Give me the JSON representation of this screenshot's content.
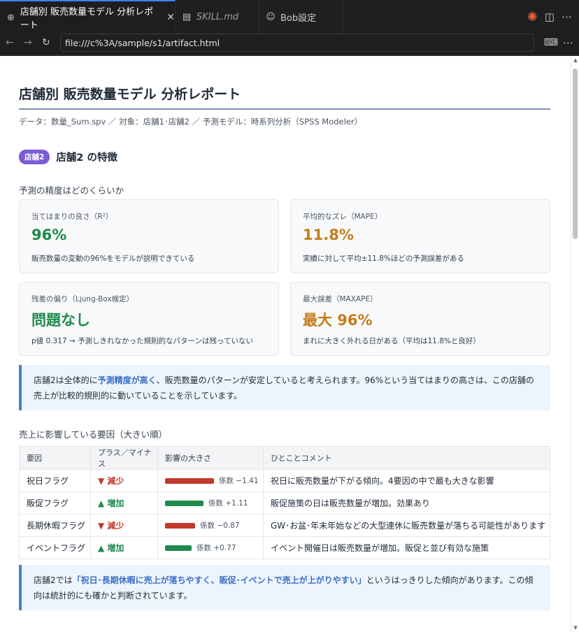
{
  "tabs": [
    {
      "icon": "globe-icon",
      "label": "店舗別 販売数量モデル 分析レポート",
      "active": true
    },
    {
      "icon": "markdown-file-icon",
      "label": "SKILL.md",
      "active": false
    },
    {
      "icon": "bot-icon",
      "label": "Bob設定",
      "active": false
    }
  ],
  "address": {
    "url": "file:///c%3A/sample/s1/artifact.html"
  },
  "report": {
    "title": "店舗別 販売数量モデル 分析レポート",
    "meta": "データ：数量_Sum.spv ／ 対象：店舗1･店舗2 ／ 予測モデル：時系列分析（SPSS Modeler）",
    "store_badge": "店舗2",
    "store_title": "店舗2 の特徴",
    "accuracy_heading": "予測の精度はどのくらいか",
    "cards": [
      {
        "label": "当てはまりの良さ（R²）",
        "value": "96%",
        "desc": "販売数量の変動の96%をモデルが説明できている",
        "tone": "green"
      },
      {
        "label": "平均的なズレ（MAPE）",
        "value": "11.8%",
        "desc": "実績に対して平均±11.8%ほどの予測誤差がある",
        "tone": "orange"
      },
      {
        "label": "残差の偏り（Ljung-Box検定）",
        "value": "問題なし",
        "desc": "p値 0.317 → 予測しきれなかった規則的なパターンは残っていない",
        "tone": "green"
      },
      {
        "label": "最大誤差（MAXAPE）",
        "value": "最大 96%",
        "desc": "まれに大きく外れる日がある（平均は11.8%と良好）",
        "tone": "orange"
      }
    ],
    "note1": {
      "pre": "店舗2は全体的に",
      "highlight": "予測精度が高く",
      "post": "、販売数量のパターンが安定していると考えられます。96%という当てはまりの高さは、この店舗の売上が比較的規則的に動いていることを示しています。"
    },
    "factors_heading": "売上に影響している要因（大きい順）",
    "table": {
      "headers": [
        "要因",
        "プラス／マイナス",
        "影響の大きさ",
        "ひとことコメント"
      ],
      "rows": [
        {
          "factor": "祝日フラグ",
          "direction": "▼ 減少",
          "sign": "down",
          "coef": -1.41,
          "coef_label": "係数 −1.41",
          "comment": "祝日に販売数量が下がる傾向。4要因の中で最も大きな影響"
        },
        {
          "factor": "販促フラグ",
          "direction": "▲ 増加",
          "sign": "up",
          "coef": 1.11,
          "coef_label": "係数 +1.11",
          "comment": "販促施策の日は販売数量が増加。効果あり"
        },
        {
          "factor": "長期休暇フラグ",
          "direction": "▼ 減少",
          "sign": "down",
          "coef": -0.87,
          "coef_label": "係数 −0.87",
          "comment": "GW･お盆･年末年始などの大型連休に販売数量が落ちる可能性があります"
        },
        {
          "factor": "イベントフラグ",
          "direction": "▲ 増加",
          "sign": "up",
          "coef": 0.77,
          "coef_label": "係数 +0.77",
          "comment": "イベント開催日は販売数量が増加。販促と並び有効な施策"
        }
      ]
    },
    "note2": {
      "pre": "店舗2では",
      "highlight": "「祝日･長期休暇に売上が落ちやすく、販促･イベントで売上が上がりやすい」",
      "post": "というはっきりした傾向があります。この傾向は統計的にも確かと判断されています。"
    }
  }
}
